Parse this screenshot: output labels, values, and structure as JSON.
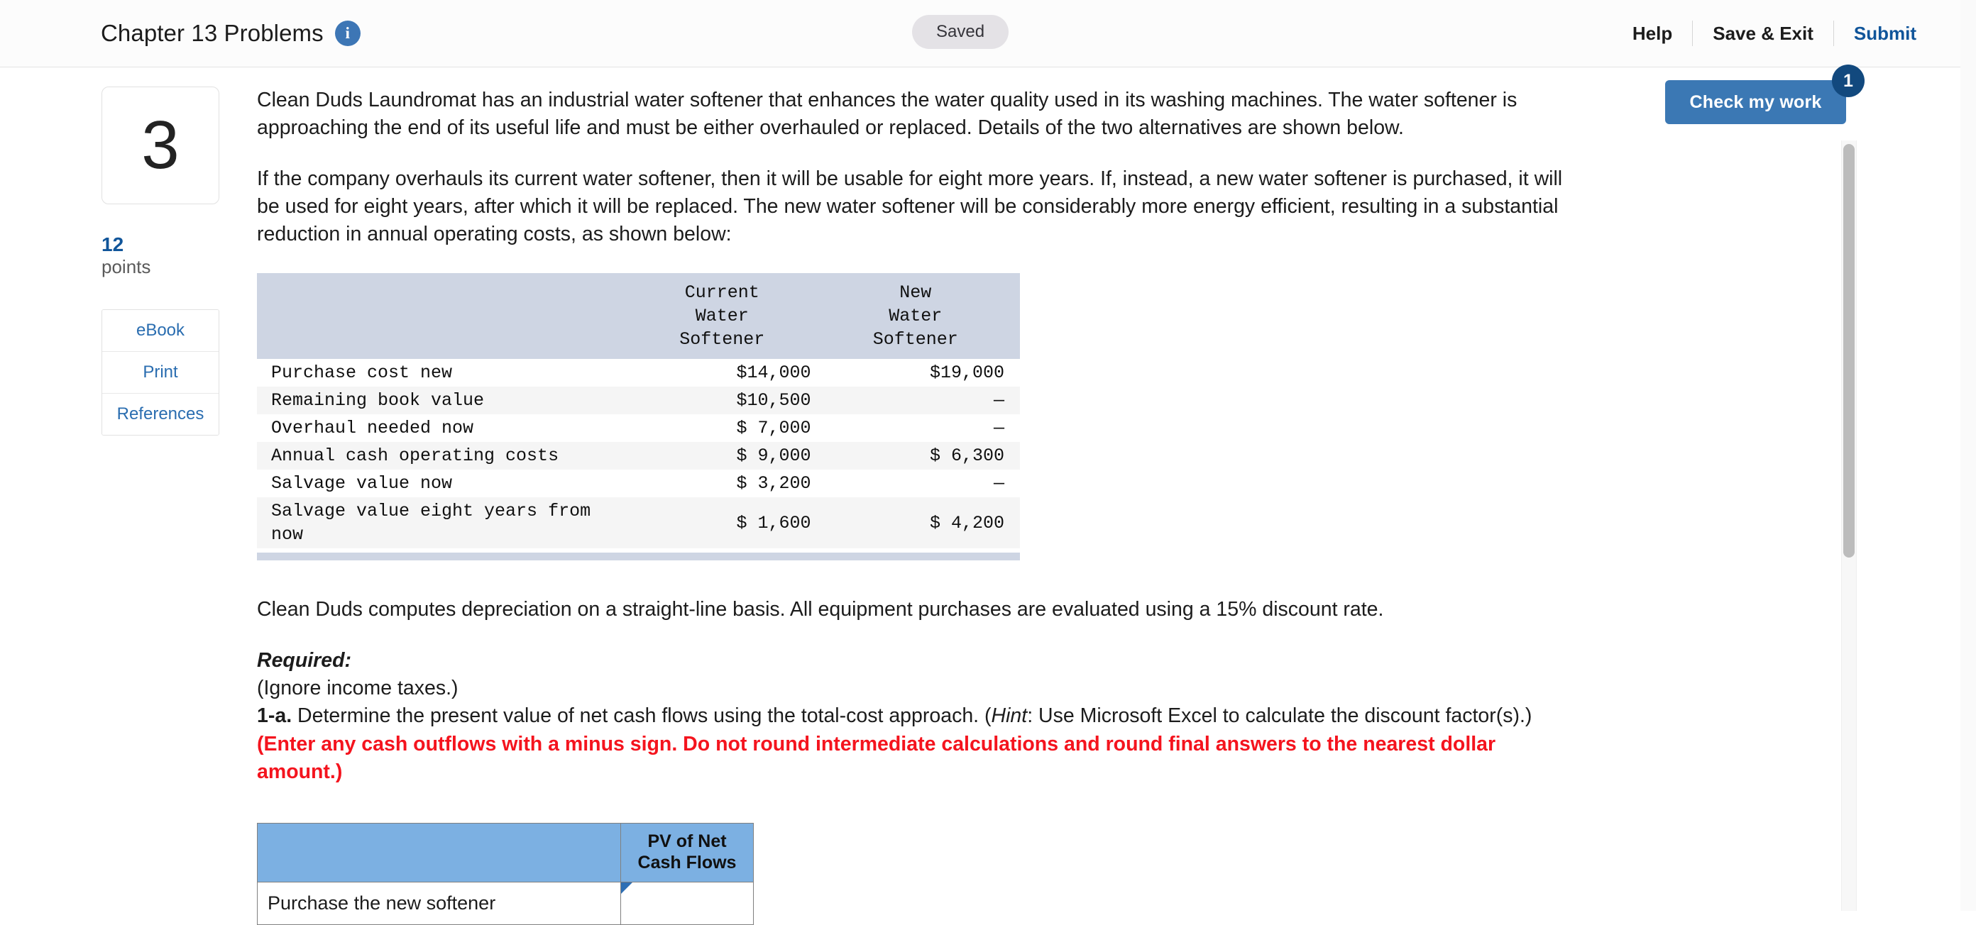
{
  "topbar": {
    "title": "Chapter 13 Problems",
    "info_icon": "info-icon",
    "status_pill": "Saved",
    "help_label": "Help",
    "save_exit_label": "Save & Exit",
    "submit_label": "Submit"
  },
  "check_my_work": {
    "label": "Check my work",
    "badge_count": "1",
    "color": "#3b78b4",
    "badge_color": "#12497e"
  },
  "rail": {
    "question_number": "3",
    "points_value": "12",
    "points_label": "points",
    "links": [
      {
        "label": "eBook"
      },
      {
        "label": "Print"
      },
      {
        "label": "References"
      }
    ]
  },
  "content": {
    "paragraph_1": "Clean Duds Laundromat has an industrial water softener that enhances the water quality used in its washing machines. The water softener is approaching the end of its useful life and must be either overhauled or replaced. Details of the two alternatives are shown below.",
    "paragraph_2": "If the company overhauls its current water softener, then it will be usable for eight more years. If, instead, a new water softener is purchased, it will be used for eight years, after which it will be replaced. The new water softener will be considerably more energy efficient, resulting in a substantial reduction in annual operating costs, as shown below:",
    "paragraph_3": "Clean Duds computes depreciation on a straight-line basis. All equipment purchases are evaluated using a 15% discount rate.",
    "required_heading": "Required:",
    "ignore_taxes": "(Ignore income taxes.)",
    "question_label": "1-a.",
    "question_text_1": " Determine the present value of net cash flows using the total-cost approach. (",
    "hint_word": "Hint",
    "question_text_2": ": Use Microsoft Excel to calculate the discount factor(s).) ",
    "red_note": "(Enter any cash outflows with a minus sign. Do not round intermediate calculations and round final answers to the nearest dollar amount.)"
  },
  "data_table": {
    "blank_header": "",
    "headers": [
      "Current\nWater\nSoftener",
      "New\nWater\nSoftener"
    ],
    "header_bg": "#ced5e3",
    "rows": [
      {
        "label": "Purchase cost new",
        "current": "$14,000",
        "new": "$19,000"
      },
      {
        "label": "Remaining book value",
        "current": "$10,500",
        "new": "—"
      },
      {
        "label": "Overhaul needed now",
        "current": "$ 7,000",
        "new": "—"
      },
      {
        "label": "Annual cash operating costs",
        "current": "$ 9,000",
        "new": "$ 6,300"
      },
      {
        "label": "Salvage value now",
        "current": "$ 3,200",
        "new": "—"
      },
      {
        "label": "Salvage value eight years from now",
        "current": "$ 1,600",
        "new": "$ 4,200"
      }
    ]
  },
  "answer_table": {
    "blank_header": "",
    "column_header": "PV of Net\nCash Flows",
    "header_bg": "#7cb0e2",
    "rows": [
      {
        "label": "Purchase the new softener",
        "value": "",
        "placeholder": ""
      }
    ]
  }
}
